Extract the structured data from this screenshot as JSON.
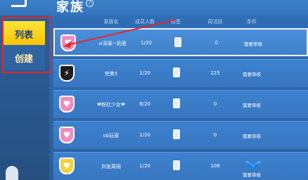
{
  "header": {
    "title": "家族",
    "help": "?"
  },
  "sidebar": {
    "tabs": [
      {
        "label": "列表"
      },
      {
        "label": "创建"
      }
    ]
  },
  "table": {
    "columns": [
      "家族名",
      "成员人数",
      "标签",
      "周活跃",
      "条件"
    ],
    "rows": [
      {
        "name": "≠深家~奶思",
        "members": "1/20",
        "activity": "0",
        "condition": "需要审核"
      },
      {
        "name": "完美5",
        "members": "1/20",
        "activity": "225",
        "condition": "需要审核"
      },
      {
        "name": "❤粉红少女❤",
        "members": "8/20",
        "activity": "0",
        "condition": "需要审核"
      },
      {
        "name": "ob玩家",
        "members": "1/20",
        "activity": "0",
        "condition": "需要审核"
      },
      {
        "name": "刘张周雨",
        "members": "1/20",
        "activity": "108",
        "condition": "需要审核"
      }
    ]
  },
  "colors": {
    "highlight_box": "#e5262f",
    "active_tab": "#f6c200",
    "panel_bg": "#2d69ad"
  },
  "icons": [
    "back-icon",
    "help-icon",
    "family-badge-icon",
    "tag-icon",
    "rank-icon"
  ]
}
